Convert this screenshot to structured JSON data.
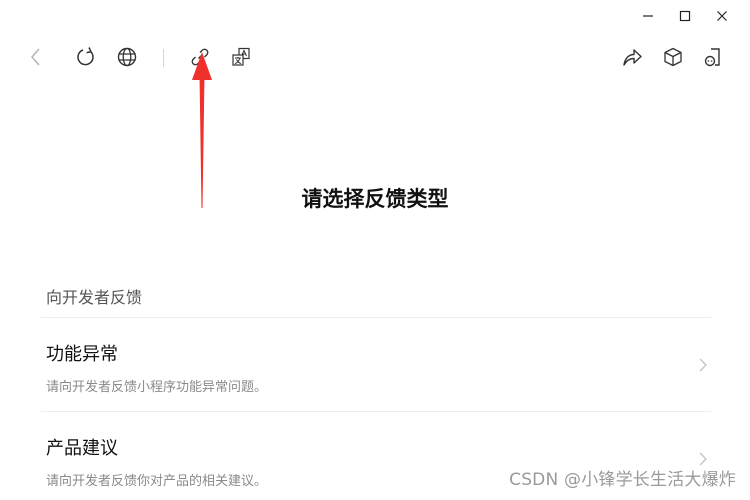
{
  "window_controls": {
    "icons": [
      "minimize-icon",
      "maximize-icon",
      "close-icon"
    ]
  },
  "toolbar": {
    "left_icons": [
      "back-icon",
      "refresh-icon",
      "globe-icon",
      "link-icon",
      "translate-icon"
    ],
    "right_icons": [
      "share-icon",
      "cube-icon",
      "feedback-icon"
    ]
  },
  "annotation": {
    "color": "#f0302b"
  },
  "page": {
    "title": "请选择反馈类型"
  },
  "section": {
    "header": "向开发者反馈",
    "items": [
      {
        "title": "功能异常",
        "description": "请向开发者反馈小程序功能异常问题。"
      },
      {
        "title": "产品建议",
        "description": "请向开发者反馈你对产品的相关建议。"
      }
    ]
  },
  "watermark": {
    "text": "CSDN @小锋学长生活大爆炸"
  }
}
